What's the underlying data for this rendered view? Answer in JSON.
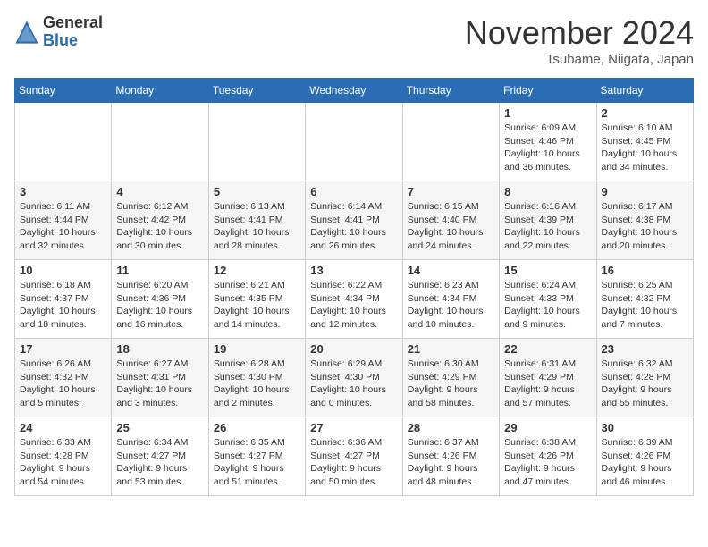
{
  "logo": {
    "general": "General",
    "blue": "Blue"
  },
  "title": "November 2024",
  "location": "Tsubame, Niigata, Japan",
  "days_of_week": [
    "Sunday",
    "Monday",
    "Tuesday",
    "Wednesday",
    "Thursday",
    "Friday",
    "Saturday"
  ],
  "weeks": [
    [
      {
        "day": "",
        "info": ""
      },
      {
        "day": "",
        "info": ""
      },
      {
        "day": "",
        "info": ""
      },
      {
        "day": "",
        "info": ""
      },
      {
        "day": "",
        "info": ""
      },
      {
        "day": "1",
        "info": "Sunrise: 6:09 AM\nSunset: 4:46 PM\nDaylight: 10 hours and 36 minutes."
      },
      {
        "day": "2",
        "info": "Sunrise: 6:10 AM\nSunset: 4:45 PM\nDaylight: 10 hours and 34 minutes."
      }
    ],
    [
      {
        "day": "3",
        "info": "Sunrise: 6:11 AM\nSunset: 4:44 PM\nDaylight: 10 hours and 32 minutes."
      },
      {
        "day": "4",
        "info": "Sunrise: 6:12 AM\nSunset: 4:42 PM\nDaylight: 10 hours and 30 minutes."
      },
      {
        "day": "5",
        "info": "Sunrise: 6:13 AM\nSunset: 4:41 PM\nDaylight: 10 hours and 28 minutes."
      },
      {
        "day": "6",
        "info": "Sunrise: 6:14 AM\nSunset: 4:41 PM\nDaylight: 10 hours and 26 minutes."
      },
      {
        "day": "7",
        "info": "Sunrise: 6:15 AM\nSunset: 4:40 PM\nDaylight: 10 hours and 24 minutes."
      },
      {
        "day": "8",
        "info": "Sunrise: 6:16 AM\nSunset: 4:39 PM\nDaylight: 10 hours and 22 minutes."
      },
      {
        "day": "9",
        "info": "Sunrise: 6:17 AM\nSunset: 4:38 PM\nDaylight: 10 hours and 20 minutes."
      }
    ],
    [
      {
        "day": "10",
        "info": "Sunrise: 6:18 AM\nSunset: 4:37 PM\nDaylight: 10 hours and 18 minutes."
      },
      {
        "day": "11",
        "info": "Sunrise: 6:20 AM\nSunset: 4:36 PM\nDaylight: 10 hours and 16 minutes."
      },
      {
        "day": "12",
        "info": "Sunrise: 6:21 AM\nSunset: 4:35 PM\nDaylight: 10 hours and 14 minutes."
      },
      {
        "day": "13",
        "info": "Sunrise: 6:22 AM\nSunset: 4:34 PM\nDaylight: 10 hours and 12 minutes."
      },
      {
        "day": "14",
        "info": "Sunrise: 6:23 AM\nSunset: 4:34 PM\nDaylight: 10 hours and 10 minutes."
      },
      {
        "day": "15",
        "info": "Sunrise: 6:24 AM\nSunset: 4:33 PM\nDaylight: 10 hours and 9 minutes."
      },
      {
        "day": "16",
        "info": "Sunrise: 6:25 AM\nSunset: 4:32 PM\nDaylight: 10 hours and 7 minutes."
      }
    ],
    [
      {
        "day": "17",
        "info": "Sunrise: 6:26 AM\nSunset: 4:32 PM\nDaylight: 10 hours and 5 minutes."
      },
      {
        "day": "18",
        "info": "Sunrise: 6:27 AM\nSunset: 4:31 PM\nDaylight: 10 hours and 3 minutes."
      },
      {
        "day": "19",
        "info": "Sunrise: 6:28 AM\nSunset: 4:30 PM\nDaylight: 10 hours and 2 minutes."
      },
      {
        "day": "20",
        "info": "Sunrise: 6:29 AM\nSunset: 4:30 PM\nDaylight: 10 hours and 0 minutes."
      },
      {
        "day": "21",
        "info": "Sunrise: 6:30 AM\nSunset: 4:29 PM\nDaylight: 9 hours and 58 minutes."
      },
      {
        "day": "22",
        "info": "Sunrise: 6:31 AM\nSunset: 4:29 PM\nDaylight: 9 hours and 57 minutes."
      },
      {
        "day": "23",
        "info": "Sunrise: 6:32 AM\nSunset: 4:28 PM\nDaylight: 9 hours and 55 minutes."
      }
    ],
    [
      {
        "day": "24",
        "info": "Sunrise: 6:33 AM\nSunset: 4:28 PM\nDaylight: 9 hours and 54 minutes."
      },
      {
        "day": "25",
        "info": "Sunrise: 6:34 AM\nSunset: 4:27 PM\nDaylight: 9 hours and 53 minutes."
      },
      {
        "day": "26",
        "info": "Sunrise: 6:35 AM\nSunset: 4:27 PM\nDaylight: 9 hours and 51 minutes."
      },
      {
        "day": "27",
        "info": "Sunrise: 6:36 AM\nSunset: 4:27 PM\nDaylight: 9 hours and 50 minutes."
      },
      {
        "day": "28",
        "info": "Sunrise: 6:37 AM\nSunset: 4:26 PM\nDaylight: 9 hours and 48 minutes."
      },
      {
        "day": "29",
        "info": "Sunrise: 6:38 AM\nSunset: 4:26 PM\nDaylight: 9 hours and 47 minutes."
      },
      {
        "day": "30",
        "info": "Sunrise: 6:39 AM\nSunset: 4:26 PM\nDaylight: 9 hours and 46 minutes."
      }
    ]
  ]
}
